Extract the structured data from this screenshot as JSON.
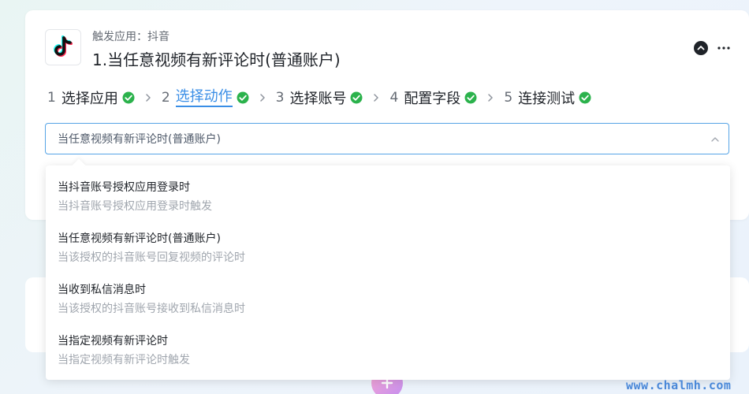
{
  "header": {
    "trigger_label": "触发应用：抖音",
    "title": "1.当任意视频有新评论时(普通账户)"
  },
  "steps": [
    {
      "num": "1",
      "label": "选择应用",
      "done": true
    },
    {
      "num": "2",
      "label": "选择动作",
      "done": true,
      "active": true
    },
    {
      "num": "3",
      "label": "选择账号",
      "done": true
    },
    {
      "num": "4",
      "label": "配置字段",
      "done": true
    },
    {
      "num": "5",
      "label": "连接测试",
      "done": true
    }
  ],
  "select": {
    "value": "当任意视频有新评论时(普通账户)"
  },
  "options": [
    {
      "title": "当抖音账号授权应用登录时",
      "desc": "当抖音账号授权应用登录时触发"
    },
    {
      "title": "当任意视频有新评论时(普通账户)",
      "desc": "当该授权的抖音账号回复视频的评论时"
    },
    {
      "title": "当收到私信消息时",
      "desc": "当该授权的抖音账号接收到私信消息时"
    },
    {
      "title": "当指定视频有新评论时",
      "desc": "当指定视频有新评论时触发"
    }
  ],
  "watermark": "www.chalmh.com",
  "colors": {
    "accent": "#3a8ee6",
    "success": "#2bb24c",
    "border_focus": "#56a4e6"
  },
  "icons": {
    "app_logo": "tiktok-logo-icon",
    "collapse": "chevron-up-circle-icon",
    "more": "more-dots-icon",
    "step_done": "check-circle-icon",
    "step_sep": "chevron-right-icon",
    "select_arrow": "chevron-up-icon"
  }
}
